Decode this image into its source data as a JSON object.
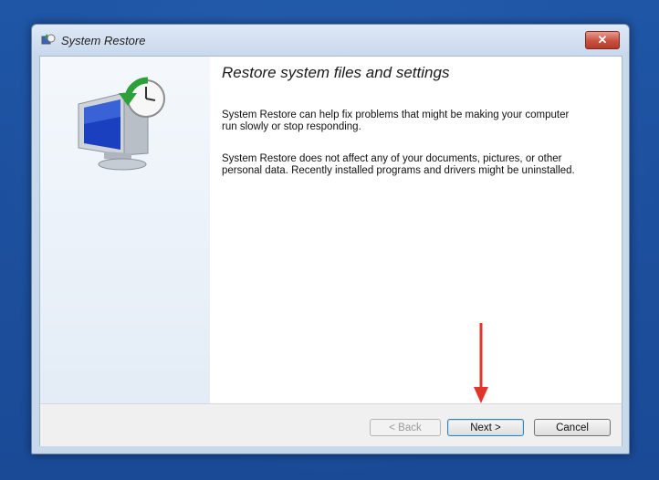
{
  "window": {
    "title": "System Restore",
    "close_glyph": "✕"
  },
  "main": {
    "heading": "Restore system files and settings",
    "paragraphs": [
      "System Restore can help fix problems that might be making your computer run slowly or stop responding.",
      "System Restore does not affect any of your documents, pictures, or other personal data. Recently installed programs and drivers might be uninstalled."
    ]
  },
  "buttons": {
    "back": "< Back",
    "next": "Next >",
    "cancel": "Cancel"
  },
  "icons": {
    "title_icon": "system-restore-icon",
    "side_icon": "computer-restore-clock-icon",
    "annotation": "red-down-arrow"
  },
  "colors": {
    "desktop": "#1c4f9d",
    "close": "#c9503f",
    "annotation_arrow": "#e0352b"
  }
}
